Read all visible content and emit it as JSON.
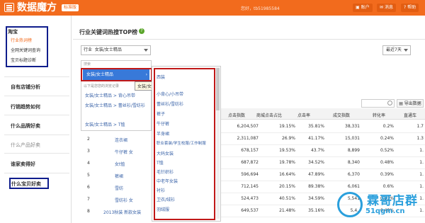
{
  "header": {
    "logo_text": "数据魔方",
    "version_badge": "标准版",
    "greeting": "您好，tb51985584",
    "buttons": [
      "账户",
      "消息",
      "帮助"
    ]
  },
  "sidebar": {
    "group_title": "淘宝",
    "group_items": [
      {
        "label": "行业热词榜",
        "active": true
      },
      {
        "label": "全网关键词查询",
        "active": false
      },
      {
        "label": "宝贝标题诊断",
        "active": false
      }
    ],
    "sections": [
      "自有店铺分析",
      "行销趋势如何",
      "什么品牌好卖",
      "什么产品好卖",
      "谁家卖得好",
      "什么宝贝好卖"
    ]
  },
  "panel": {
    "title": "行业关键词热搜TOP榜",
    "category_label": "行业",
    "category_value": "女装/女士精品",
    "period_value": "最近7天"
  },
  "cascade": {
    "label": "搜索",
    "highlighted": "女装/女士精品",
    "hint": "以下是您您的浏览记录",
    "history": [
      "女装/女士精品 > 背心吊带",
      "女装/女士精品 > 蕾丝衫/雪纺衫",
      "女装/女士精品 > T恤"
    ],
    "tooltip": "女装/女士精品",
    "sub_options": [
      "西装",
      "小背心/小吊带",
      "蕾丝衫/雪纺衫",
      "裤子",
      "牛仔裤",
      "半身裙",
      "职业套装/学生校服/工作制服",
      "大码女装",
      "T恤",
      "毛针织衫",
      "中老年女装",
      "衬衫",
      "卫衣/绒衫",
      "羽绒服"
    ]
  },
  "table": {
    "export_label": "导出数据",
    "headers": [
      "点击指数",
      "商城点击占比",
      "点击率",
      "成交指数",
      "转化率",
      "直通车"
    ],
    "rows": [
      [
        "6,204,507",
        "19.15%",
        "35.81%",
        "38,331",
        "0.2%",
        "1.7"
      ],
      [
        "2,311,087",
        "26.9%",
        "41.17%",
        "15,031",
        "0.24%",
        "1.3"
      ],
      [
        "678,157",
        "19.53%",
        "43.7%",
        "8,899",
        "0.52%",
        "1."
      ],
      [
        "687,872",
        "19.78%",
        "34.52%",
        "8,340",
        "0.48%",
        "1."
      ],
      [
        "596,694",
        "16.64%",
        "47.89%",
        "6,370",
        "0.39%",
        "1."
      ],
      [
        "712,145",
        "20.15%",
        "89.38%",
        "6,061",
        "0.6%",
        "1."
      ],
      [
        "524,473",
        "40.51%",
        "34.59%",
        "5,541",
        "0.51%",
        "1."
      ],
      [
        "649,537",
        "21.48%",
        "35.16%",
        "5,4..",
        "0.49%",
        "1."
      ]
    ]
  },
  "bottom_list": {
    "numbers": [
      "2",
      "3",
      "4",
      "5",
      "6",
      "7",
      "8"
    ],
    "keywords": [
      "连衣裙",
      "牛仔裤 女",
      "女t恤",
      "裤裙",
      "雪纺",
      "雪纺衫 女",
      "2013秋装 新款女装"
    ]
  },
  "watermark": {
    "text": "霖哥店群",
    "url": "51qgm.cn"
  },
  "colors": {
    "brand": "#f26b1d",
    "highlight_blue": "#3879d9",
    "annotation_red": "#c01818",
    "annotation_navy": "#0f1d8c",
    "watermark": "#2a9fdc"
  }
}
